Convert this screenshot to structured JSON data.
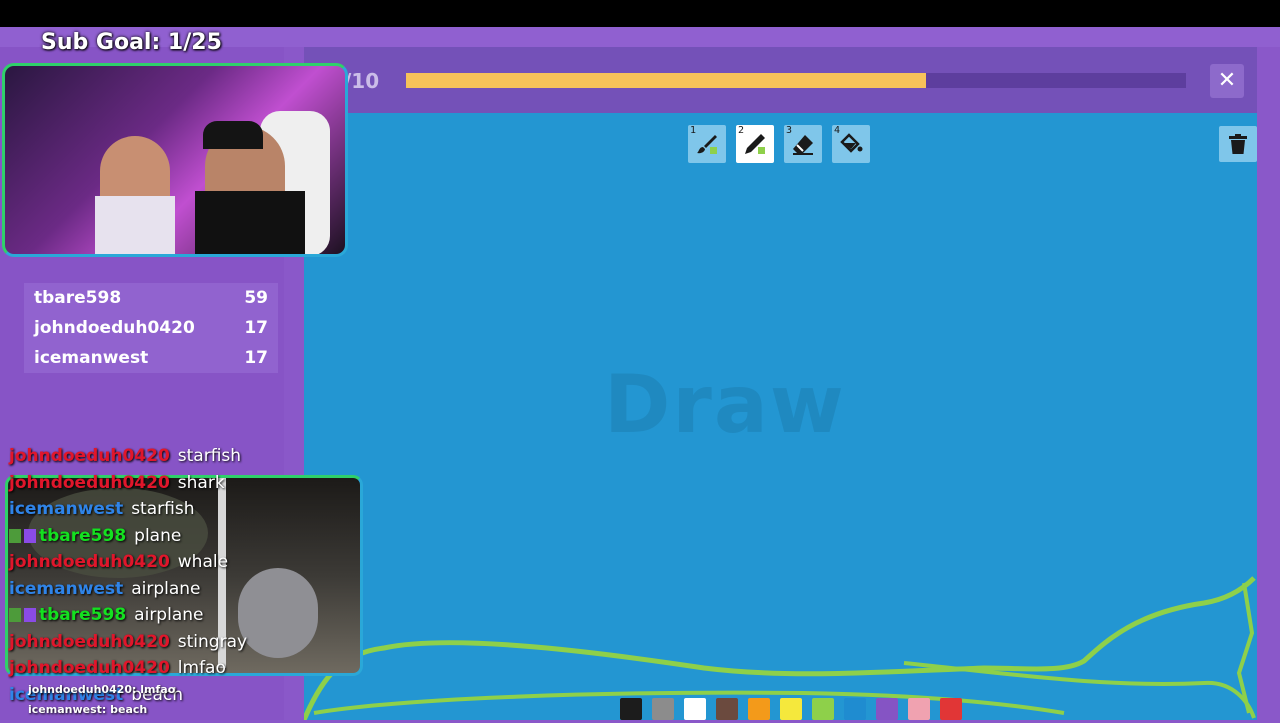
{
  "overlay": {
    "sub_goal": "Sub Goal: 1/25"
  },
  "game": {
    "round_text": "/10",
    "progress_fraction": 0.667,
    "close_label": "✕",
    "watermark": "Draw"
  },
  "tools": [
    {
      "num": "1",
      "name": "brush"
    },
    {
      "num": "2",
      "name": "pencil"
    },
    {
      "num": "3",
      "name": "eraser"
    },
    {
      "num": "4",
      "name": "fill"
    }
  ],
  "palette": [
    "#1c1c1c",
    "#8c8c8c",
    "#ffffff",
    "#6b4a3e",
    "#f39a1a",
    "#f5e83c",
    "#8ed04a",
    "#1f8cd0",
    "#8554c4",
    "#f0a2b0",
    "#e13636"
  ],
  "scoreboard": [
    {
      "name": "tbare598",
      "score": "59"
    },
    {
      "name": "johndoeduh0420",
      "score": "17"
    },
    {
      "name": "icemanwest",
      "score": "17"
    }
  ],
  "chat": [
    {
      "user": "johndoeduh0420",
      "msg": "starfish",
      "color": "red",
      "badges": false
    },
    {
      "user": "johndoeduh0420",
      "msg": "shark",
      "color": "red",
      "badges": false
    },
    {
      "user": "icemanwest",
      "msg": "starfish",
      "color": "blue",
      "badges": false
    },
    {
      "user": "tbare598",
      "msg": "plane",
      "color": "green",
      "badges": true
    },
    {
      "user": "johndoeduh0420",
      "msg": "whale",
      "color": "red",
      "badges": false
    },
    {
      "user": "icemanwest",
      "msg": "airplane",
      "color": "blue",
      "badges": false
    },
    {
      "user": "tbare598",
      "msg": "airplane",
      "color": "green",
      "badges": true
    },
    {
      "user": "johndoeduh0420",
      "msg": "stingray",
      "color": "red",
      "badges": false
    },
    {
      "user": "johndoeduh0420",
      "msg": "lmfao",
      "color": "red",
      "badges": false
    },
    {
      "user": "icemanwest",
      "msg": "beach",
      "color": "blue",
      "badges": false
    }
  ],
  "mini_chat": [
    "johndoeduh0420: lmfao",
    "icemanwest: beach"
  ]
}
